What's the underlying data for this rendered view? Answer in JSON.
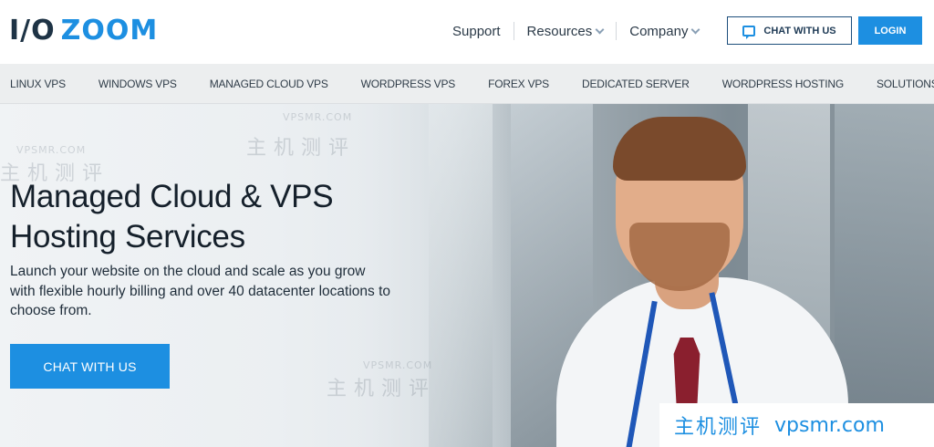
{
  "header": {
    "logo": {
      "part1": "I/O",
      "part2": "ZOOM"
    },
    "nav": [
      {
        "label": "Support",
        "dropdown": false
      },
      {
        "label": "Resources",
        "dropdown": true
      },
      {
        "label": "Company",
        "dropdown": true
      }
    ],
    "chat_button": "CHAT WITH US",
    "login_button": "LOGIN"
  },
  "product_nav": [
    "LINUX VPS",
    "WINDOWS VPS",
    "MANAGED CLOUD VPS",
    "WORDPRESS VPS",
    "FOREX VPS",
    "DEDICATED SERVER",
    "WORDPRESS HOSTING",
    "SOLUTIONS"
  ],
  "hero": {
    "title": "Managed Cloud & VPS Hosting Services",
    "subtitle": "Launch your website on the cloud and scale as you grow with flexible hourly billing and over 40 datacenter locations to choose from.",
    "cta": "CHAT WITH US"
  },
  "watermark": {
    "cn": "主机测评",
    "en": "VPSMR.COM",
    "badge_cn": "主机测评",
    "badge_en": "vpsmr.com"
  },
  "colors": {
    "accent": "#1d8fe1",
    "dark": "#1e3345"
  },
  "icons": {
    "chat": "chat-bubble-icon",
    "caret": "chevron-down-icon"
  }
}
